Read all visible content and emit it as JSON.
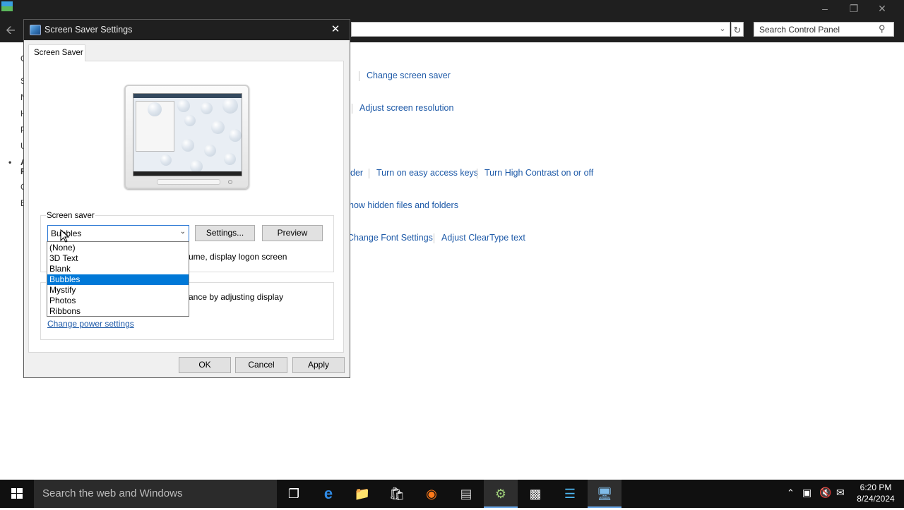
{
  "control_panel": {
    "search_placeholder": "Search Control Panel",
    "left_letters": [
      "C",
      "S",
      "N",
      "H",
      "P",
      "U",
      "A",
      "F",
      "C",
      "E"
    ],
    "links": {
      "change_screen_saver": "Change screen saver",
      "adjust_resolution": "Adjust screen resolution",
      "narrator_fragment": "der",
      "easy_access_keys": "Turn on easy access keys",
      "high_contrast": "Turn High Contrast on or off",
      "hidden_files": "how hidden files and folders",
      "font_settings": "Change Font Settings",
      "cleartype": "Adjust ClearType text"
    }
  },
  "dialog": {
    "title": "Screen Saver Settings",
    "tab": "Screen Saver",
    "group_label": "Screen saver",
    "selected": "Bubbles",
    "settings_button": "Settings...",
    "preview_button": "Preview",
    "resume_text_fragment": "ume, display logon screen",
    "power_text_fragment": "ance by adjusting display",
    "power_link": "Change power settings",
    "ok": "OK",
    "cancel": "Cancel",
    "apply": "Apply",
    "options": [
      "(None)",
      "3D Text",
      "Blank",
      "Bubbles",
      "Mystify",
      "Photos",
      "Ribbons"
    ]
  },
  "taskbar": {
    "search_placeholder": "Search the web and Windows",
    "time": "6:20 PM",
    "date": "8/24/2024"
  }
}
